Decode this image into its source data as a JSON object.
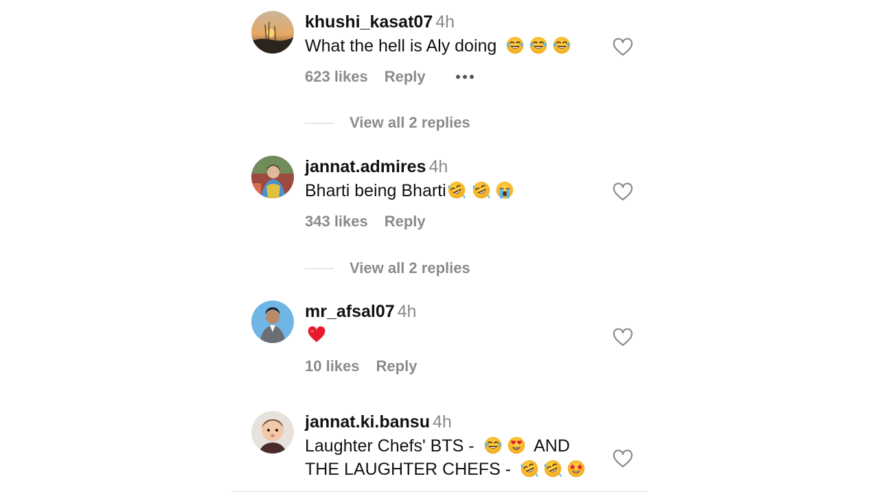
{
  "comments": [
    {
      "username": "khushi_kasat07",
      "time": "4h",
      "text": "What the hell is Aly doing",
      "emojis": [
        "joy-emoji",
        "joy-emoji",
        "joy-emoji"
      ],
      "likes": "623 likes",
      "reply": "Reply",
      "has_more_menu": true,
      "view_replies": "View all 2 replies"
    },
    {
      "username": "jannat.admires",
      "time": "4h",
      "text": "Bharti being Bharti",
      "emojis": [
        "rofl-emoji",
        "rofl-emoji",
        "loudly-crying-emoji"
      ],
      "likes": "343 likes",
      "reply": "Reply",
      "view_replies": "View all 2 replies"
    },
    {
      "username": "mr_afsal07",
      "time": "4h",
      "text": "",
      "emojis": [
        "red-heart-emoji"
      ],
      "likes": "10 likes",
      "reply": "Reply"
    },
    {
      "username": "jannat.ki.bansu",
      "time": "4h",
      "text_line1": "Laughter Chefs' BTS -",
      "text_line1_emojis": [
        "joy-emoji",
        "heart-eyes-emoji"
      ],
      "text_line1_tail": "AND",
      "text_line2": "THE LAUGHTER CHEFS -",
      "text_line2_emojis": [
        "rofl-emoji",
        "rofl-emoji",
        "star-struck-emoji"
      ]
    }
  ],
  "colors": {
    "muted_text": "#8a8a8a",
    "primary_text": "#111111",
    "emoji_yellow": "#f7c02a",
    "heart_red": "#e8192c"
  }
}
